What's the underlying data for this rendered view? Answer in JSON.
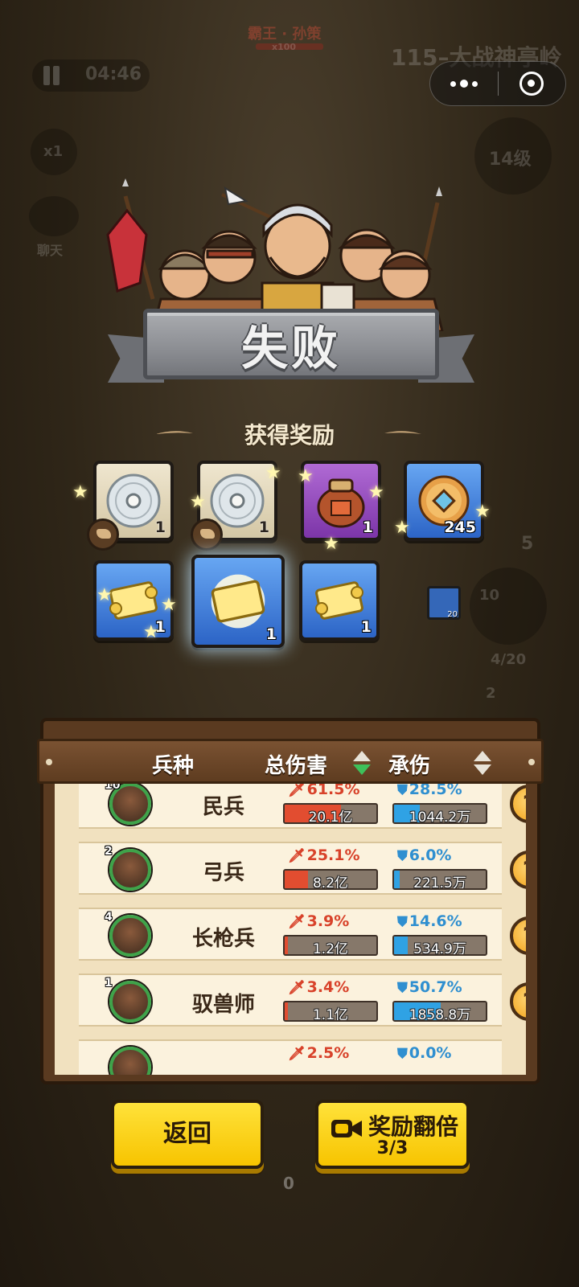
{
  "background": {
    "boss_name": "霸王 · 孙策",
    "boss_multiplier": "x100",
    "stage_title": "115–大战神亭岭",
    "timer": "04:46",
    "speed": "x1",
    "chat_label": "聊天",
    "level_badge": "14级",
    "side_count": "5",
    "side_level": "10",
    "unit_capacity": "4/20",
    "side_level_2": "2",
    "bottom_value": "0"
  },
  "result": {
    "title": "失败",
    "rewards_title": "获得奖励"
  },
  "rewards": [
    {
      "icon": "silver-disc-icon",
      "rarity": "white",
      "qty": "1"
    },
    {
      "icon": "silver-disc-icon",
      "rarity": "white",
      "qty": "1"
    },
    {
      "icon": "wine-jar-icon",
      "rarity": "purple",
      "qty": "1"
    },
    {
      "icon": "copper-coin-icon",
      "rarity": "blue",
      "qty": "245"
    },
    {
      "icon": "scroll-icon",
      "rarity": "blue",
      "qty": "1"
    },
    {
      "icon": "scroll-icon",
      "rarity": "blue",
      "qty": "1"
    },
    {
      "icon": "scroll-icon",
      "rarity": "blue",
      "qty": "1"
    }
  ],
  "extra_item": {
    "icon": "map-scroll-icon",
    "qty": "20"
  },
  "stats": {
    "headers": {
      "unit": "兵种",
      "damage": "总伤害",
      "tanked": "承伤"
    },
    "rows": [
      {
        "level": "10",
        "name": "民兵",
        "damage_pct": "61.5%",
        "damage": "20.1亿",
        "damage_fill": 0.615,
        "tank_pct": "28.5%",
        "tank": "1044.2万",
        "tank_fill": 0.285
      },
      {
        "level": "2",
        "name": "弓兵",
        "damage_pct": "25.1%",
        "damage": "8.2亿",
        "damage_fill": 0.251,
        "tank_pct": "6.0%",
        "tank": "221.5万",
        "tank_fill": 0.06
      },
      {
        "level": "4",
        "name": "长枪兵",
        "damage_pct": "3.9%",
        "damage": "1.2亿",
        "damage_fill": 0.039,
        "tank_pct": "14.6%",
        "tank": "534.9万",
        "tank_fill": 0.146
      },
      {
        "level": "1",
        "name": "驭兽师",
        "damage_pct": "3.4%",
        "damage": "1.1亿",
        "damage_fill": 0.034,
        "tank_pct": "50.7%",
        "tank": "1858.8万",
        "tank_fill": 0.507
      },
      {
        "level": "",
        "name": "",
        "damage_pct": "2.5%",
        "damage": "",
        "damage_fill": 0.025,
        "tank_pct": "0.0%",
        "tank": "",
        "tank_fill": 0.0
      }
    ],
    "help_symbol": "?"
  },
  "buttons": {
    "back": "返回",
    "double_reward": "奖励翻倍",
    "double_count": "3/3"
  },
  "colors": {
    "button_yellow": "#f7c400",
    "damage_red": "#d8422a",
    "tank_blue": "#2f8fd0",
    "banner_gray": "#8b8d92"
  }
}
